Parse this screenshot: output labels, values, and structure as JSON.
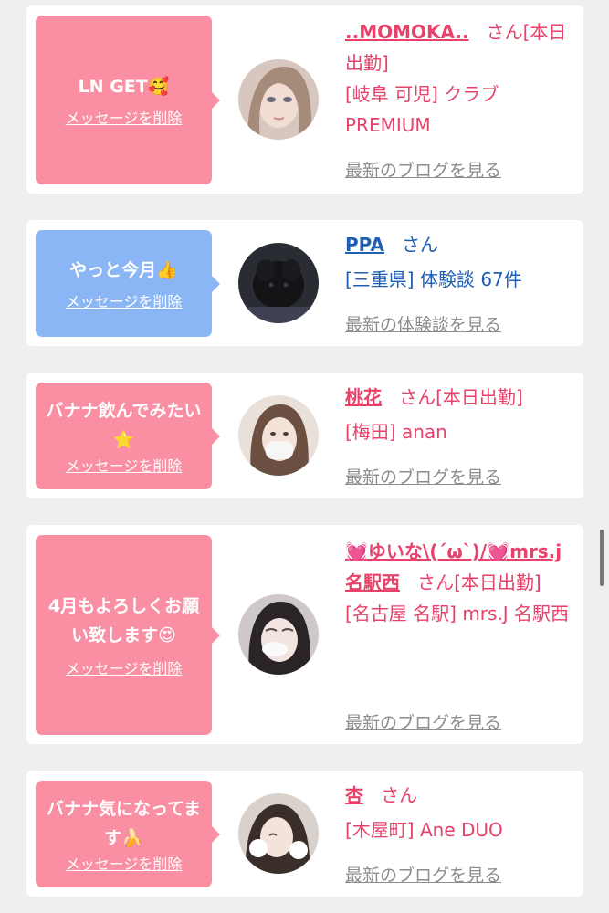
{
  "delete_label": "メッセージを削除",
  "messages": [
    {
      "message": "LN GET🥰",
      "message_color": "pink",
      "name": "..MOMOKA..",
      "suffix": "さん[本日出勤]",
      "detail": "[岐阜 可児] クラブPREMIUM",
      "link": "最新のブログを見る"
    },
    {
      "message": "やっと今月👍",
      "message_color": "blue",
      "name": "PPA",
      "suffix": "さん",
      "detail": "[三重県] 体験談 67件",
      "link": "最新の体験談を見る"
    },
    {
      "message": "バナナ飲んでみたい⭐",
      "message_color": "pink",
      "name": "桃花",
      "suffix": "さん[本日出勤]",
      "detail": "[梅田] anan",
      "link": "最新のブログを見る"
    },
    {
      "message": "4月もよろしくお願い致します😍",
      "message_color": "pink",
      "name": "💓ゆいな\\(´ω`)/💓mrs.j名駅西",
      "suffix": "さん[本日出勤]",
      "detail": "[名古屋 名駅] mrs.J 名駅西",
      "link": "最新のブログを見る"
    },
    {
      "message": "バナナ気になってます🍌",
      "message_color": "pink",
      "name": "杏",
      "suffix": "さん",
      "detail": "[木屋町] Ane DUO",
      "link": "最新のブログを見る"
    }
  ],
  "colors": {
    "pink_bubble": "#fa8fa3",
    "blue_bubble": "#8bb6f6",
    "pink_text": "#e7426a",
    "blue_text": "#1e5fb3",
    "link_gray": "#8d8d8d"
  }
}
